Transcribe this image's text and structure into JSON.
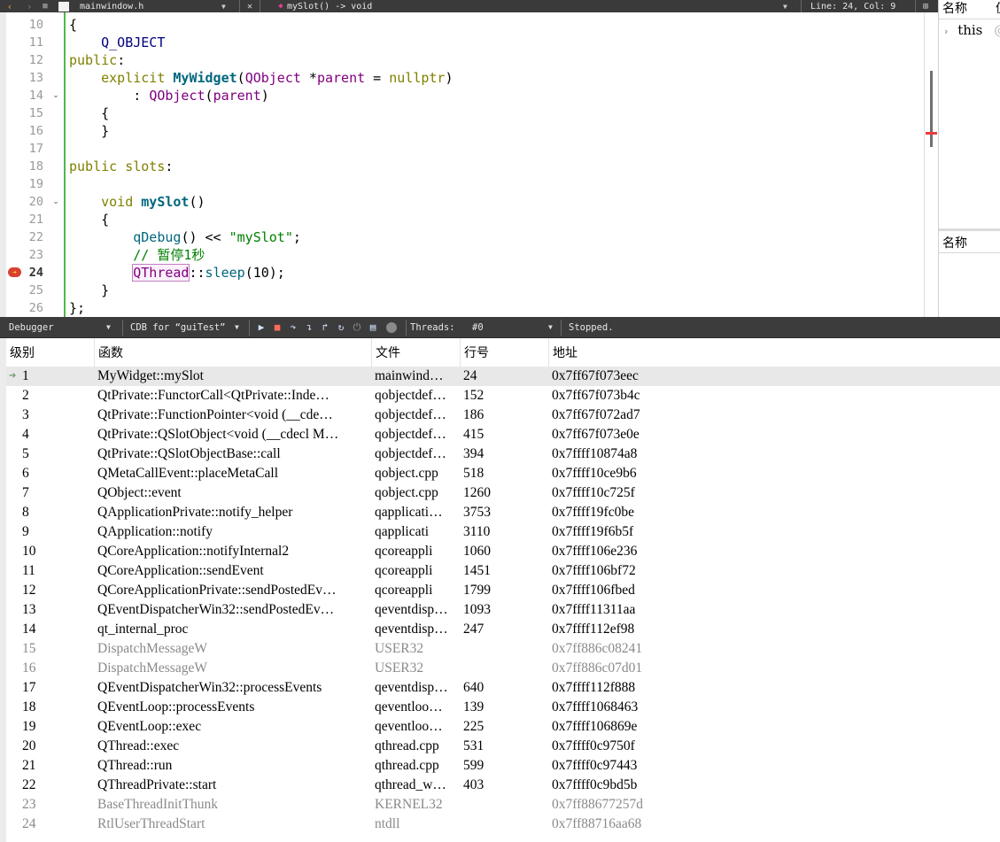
{
  "editor_toolbar": {
    "document": "mainwindow.h",
    "function": "mySlot() -> void",
    "line_col": "Line: 24, Col: 9"
  },
  "editor": {
    "line_numbers": [
      "10",
      "11",
      "12",
      "13",
      "14",
      "15",
      "16",
      "17",
      "18",
      "19",
      "20",
      "21",
      "22",
      "23",
      "24",
      "25",
      "26"
    ],
    "current_line": "24"
  },
  "locals": {
    "header_name": "名称",
    "header_value": "值",
    "row_this": "this",
    "row_this_value": "@",
    "header2_name": "名称"
  },
  "debug_toolbar": {
    "view": "Debugger",
    "engine": "CDB for “guiTest”",
    "threads_label": "Threads:",
    "thread": "#0",
    "status": "Stopped."
  },
  "stack": {
    "headers": {
      "level": "级别",
      "function": "函数",
      "file": "文件",
      "line": "行号",
      "address": "地址"
    },
    "rows": [
      {
        "level": "1",
        "function": "MyWidget::mySlot",
        "file": "mainwind…",
        "line": "24",
        "address": "0x7ff67f073eec"
      },
      {
        "level": "2",
        "function": "QtPrivate::FunctorCall<QtPrivate::Inde…",
        "file": "qobjectdef…",
        "line": "152",
        "address": "0x7ff67f073b4c"
      },
      {
        "level": "3",
        "function": "QtPrivate::FunctionPointer<void (__cde…",
        "file": "qobjectdef…",
        "line": "186",
        "address": "0x7ff67f072ad7"
      },
      {
        "level": "4",
        "function": "QtPrivate::QSlotObject<void (__cdecl M…",
        "file": "qobjectdef…",
        "line": "415",
        "address": "0x7ff67f073e0e"
      },
      {
        "level": "5",
        "function": "QtPrivate::QSlotObjectBase::call",
        "file": "qobjectdef…",
        "line": "394",
        "address": "0x7ffff10874a8"
      },
      {
        "level": "6",
        "function": "QMetaCallEvent::placeMetaCall",
        "file": "qobject.cpp",
        "line": "518",
        "address": "0x7ffff10ce9b6"
      },
      {
        "level": "7",
        "function": "QObject::event",
        "file": "qobject.cpp",
        "line": "1260",
        "address": "0x7ffff10c725f"
      },
      {
        "level": "8",
        "function": "QApplicationPrivate::notify_helper",
        "file": "qapplicati…",
        "line": "3753",
        "address": "0x7ffff19fc0be"
      },
      {
        "level": "9",
        "function": "QApplication::notify",
        "file": "qapplicati",
        "line": "3110",
        "address": "0x7ffff19f6b5f"
      },
      {
        "level": "10",
        "function": "QCoreApplication::notifyInternal2",
        "file": "qcoreappli",
        "line": "1060",
        "address": "0x7ffff106e236"
      },
      {
        "level": "11",
        "function": "QCoreApplication::sendEvent",
        "file": "qcoreappli",
        "line": "1451",
        "address": "0x7ffff106bf72"
      },
      {
        "level": "12",
        "function": "QCoreApplicationPrivate::sendPostedEv…",
        "file": "qcoreappli",
        "line": "1799",
        "address": "0x7ffff106fbed"
      },
      {
        "level": "13",
        "function": "QEventDispatcherWin32::sendPostedEv…",
        "file": "qeventdisp…",
        "line": "1093",
        "address": "0x7ffff11311aa"
      },
      {
        "level": "14",
        "function": "qt_internal_proc",
        "file": "qeventdisp…",
        "line": "247",
        "address": "0x7ffff112ef98"
      },
      {
        "level": "15",
        "function": "DispatchMessageW",
        "file": "USER32",
        "line": "",
        "address": "0x7ff886c08241",
        "dim": true
      },
      {
        "level": "16",
        "function": "DispatchMessageW",
        "file": "USER32",
        "line": "",
        "address": "0x7ff886c07d01",
        "dim": true
      },
      {
        "level": "17",
        "function": "QEventDispatcherWin32::processEvents",
        "file": "qeventdisp…",
        "line": "640",
        "address": "0x7ffff112f888"
      },
      {
        "level": "18",
        "function": "QEventLoop::processEvents",
        "file": "qeventloo…",
        "line": "139",
        "address": "0x7ffff1068463"
      },
      {
        "level": "19",
        "function": "QEventLoop::exec",
        "file": "qeventloo…",
        "line": "225",
        "address": "0x7ffff106869e"
      },
      {
        "level": "20",
        "function": "QThread::exec",
        "file": "qthread.cpp",
        "line": "531",
        "address": "0x7ffff0c9750f"
      },
      {
        "level": "21",
        "function": "QThread::run",
        "file": "qthread.cpp",
        "line": "599",
        "address": "0x7ffff0c97443"
      },
      {
        "level": "22",
        "function": "QThreadPrivate::start",
        "file": "qthread_w…",
        "line": "403",
        "address": "0x7ffff0c9bd5b"
      },
      {
        "level": "23",
        "function": "BaseThreadInitThunk",
        "file": "KERNEL32",
        "line": "",
        "address": "0x7ff88677257d",
        "dim": true
      },
      {
        "level": "24",
        "function": "RtlUserThreadStart",
        "file": "ntdll",
        "line": "",
        "address": "0x7ff88716aa68",
        "dim": true
      }
    ]
  },
  "colors": {
    "keyword": "#808000",
    "type": "#800080",
    "function": "#00677c",
    "string": "#008000",
    "toolbar_bg": "#3c3c3c",
    "selection": "#e8e8e8",
    "breakpoint": "#d84030"
  }
}
